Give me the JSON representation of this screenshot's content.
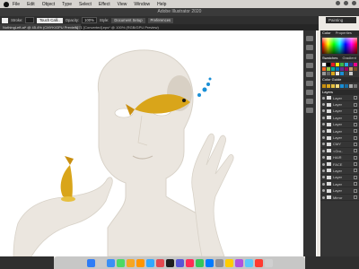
{
  "menubar": {
    "items": [
      "File",
      "Edit",
      "Object",
      "Type",
      "Select",
      "Effect",
      "View",
      "Window",
      "Help"
    ]
  },
  "window": {
    "title": "Adobe Illustrator 2020",
    "workspace": "Painting"
  },
  "controlbar": {
    "stroke_label": "Stroke:",
    "touch_callig": "Touch Calli..",
    "opacity_label": "Opacity:",
    "opacity_value": "100%",
    "style_label": "Style:",
    "document_setup": "Document Setup",
    "preferences": "Preferences"
  },
  "tabs": [
    {
      "label": "NothingLeft.ai* @ 45.4% (CMYK/GPU Preview)",
      "active": true
    },
    {
      "label": "7271 [Converted].eps* @ 100% (RGB/GPU Preview)",
      "active": false
    }
  ],
  "panels": {
    "color_tabs": [
      "Color",
      "Properties"
    ],
    "swatches_tabs": [
      "Swatches",
      "Gradient"
    ],
    "color_guide": "Color Guide",
    "layers_title": "Layers",
    "layer_names": [
      "Layer",
      "Layer",
      "Layer",
      "Layer",
      "Layer",
      "Layer",
      "Layer",
      "CMY",
      "<Gro..",
      "HAIR",
      "FACE",
      "Layer",
      "Layer",
      "Layer",
      "Layer",
      "Mirror"
    ]
  },
  "colors": {
    "fish": "#d9a51a",
    "skin": "#ebe6df",
    "bubbles": "#1a8fd6"
  }
}
